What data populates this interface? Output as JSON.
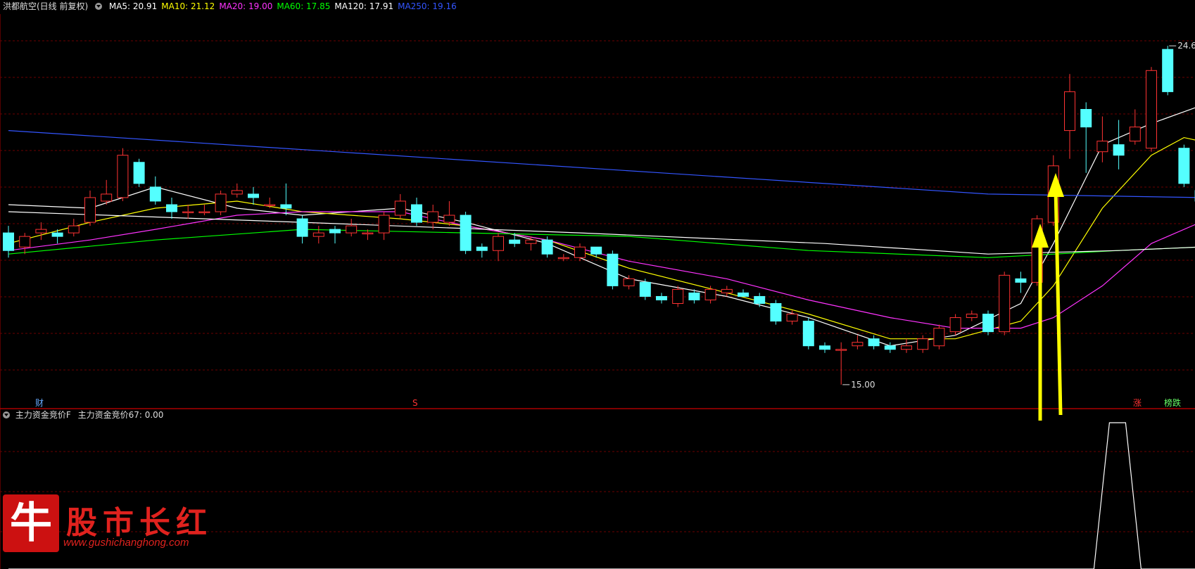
{
  "header": {
    "stock": "洪都航空(日线 前复权)",
    "indicators": [
      {
        "label": "MA5: 20.91",
        "color": "#ffffff"
      },
      {
        "label": "MA10: 21.12",
        "color": "#ffff00"
      },
      {
        "label": "MA20: 19.00",
        "color": "#ff33ff"
      },
      {
        "label": "MA60: 17.85",
        "color": "#00ff00"
      },
      {
        "label": "MA120: 17.91",
        "color": "#ffffff"
      },
      {
        "label": "MA250: 19.16",
        "color": "#3355ff"
      }
    ]
  },
  "sub_header": {
    "name": "主力资金竞价F",
    "value_label": "主力资金竞价67: 0.00"
  },
  "markers": {
    "cai": "财",
    "s": "S",
    "zhang": "涨",
    "bang": "榜跌"
  },
  "logo": {
    "glyph": "牛",
    "name": "股市长红",
    "url": "www.gushichanghong.com"
  },
  "colors": {
    "up": "#ff3333",
    "down": "#54ffff",
    "grid": "#6b0000",
    "bg": "#000000"
  },
  "chart_data": {
    "type": "candlestick",
    "price_range": [
      14.5,
      25.5
    ],
    "high_label": "24.60",
    "low_label": "15.00",
    "candles": [
      [
        19.3,
        18.8,
        19.5,
        18.6
      ],
      [
        18.9,
        19.2,
        19.3,
        18.7
      ],
      [
        19.3,
        19.4,
        19.6,
        19.1
      ],
      [
        19.3,
        19.2,
        19.4,
        19.0
      ],
      [
        19.3,
        19.5,
        19.7,
        19.2
      ],
      [
        19.6,
        20.3,
        20.5,
        19.5
      ],
      [
        20.2,
        20.4,
        20.8,
        20.1
      ],
      [
        20.3,
        21.5,
        21.7,
        20.2
      ],
      [
        21.3,
        20.7,
        21.4,
        20.6
      ],
      [
        20.6,
        20.2,
        20.9,
        20.1
      ],
      [
        20.1,
        19.9,
        20.3,
        19.7
      ],
      [
        19.9,
        19.9,
        20.1,
        19.7
      ],
      [
        19.9,
        19.9,
        20.1,
        19.8
      ],
      [
        19.9,
        20.4,
        20.5,
        19.8
      ],
      [
        20.4,
        20.5,
        20.7,
        20.3
      ],
      [
        20.4,
        20.3,
        20.6,
        20.1
      ],
      [
        20.1,
        20.1,
        20.3,
        20.0
      ],
      [
        20.1,
        20.0,
        20.7,
        19.8
      ],
      [
        19.7,
        19.2,
        19.8,
        19.0
      ],
      [
        19.2,
        19.3,
        19.5,
        19.0
      ],
      [
        19.4,
        19.3,
        19.5,
        19.0
      ],
      [
        19.3,
        19.5,
        19.7,
        19.2
      ],
      [
        19.3,
        19.3,
        19.4,
        19.1
      ],
      [
        19.3,
        19.8,
        19.9,
        19.1
      ],
      [
        19.8,
        20.2,
        20.4,
        19.7
      ],
      [
        20.1,
        19.6,
        20.3,
        19.5
      ],
      [
        19.6,
        19.9,
        20.1,
        19.4
      ],
      [
        19.6,
        19.8,
        20.2,
        19.5
      ],
      [
        19.8,
        18.8,
        19.9,
        18.7
      ],
      [
        18.9,
        18.8,
        19.0,
        18.6
      ],
      [
        18.8,
        19.2,
        19.3,
        18.5
      ],
      [
        19.1,
        19.0,
        19.3,
        18.9
      ],
      [
        19.0,
        19.1,
        19.2,
        18.8
      ],
      [
        19.1,
        18.7,
        19.2,
        18.6
      ],
      [
        18.6,
        18.6,
        18.7,
        18.5
      ],
      [
        18.6,
        18.9,
        19.0,
        18.5
      ],
      [
        18.9,
        18.7,
        18.9,
        18.6
      ],
      [
        18.7,
        17.8,
        18.8,
        17.7
      ],
      [
        17.8,
        18.0,
        18.1,
        17.7
      ],
      [
        17.9,
        17.5,
        18.0,
        17.4
      ],
      [
        17.5,
        17.4,
        17.6,
        17.3
      ],
      [
        17.3,
        17.7,
        17.8,
        17.2
      ],
      [
        17.6,
        17.4,
        17.7,
        17.3
      ],
      [
        17.4,
        17.7,
        17.8,
        17.3
      ],
      [
        17.6,
        17.7,
        17.8,
        17.5
      ],
      [
        17.6,
        17.5,
        17.7,
        17.5
      ],
      [
        17.5,
        17.3,
        17.6,
        17.2
      ],
      [
        17.3,
        16.8,
        17.4,
        16.7
      ],
      [
        16.8,
        17.0,
        17.1,
        16.7
      ],
      [
        16.8,
        16.1,
        16.9,
        16.0
      ],
      [
        16.1,
        16.0,
        16.2,
        15.9
      ],
      [
        16.0,
        16.0,
        16.2,
        15.0
      ],
      [
        16.1,
        16.2,
        16.4,
        16.0
      ],
      [
        16.3,
        16.1,
        16.4,
        16.0
      ],
      [
        16.1,
        16.0,
        16.2,
        15.9
      ],
      [
        16.0,
        16.1,
        16.3,
        15.9
      ],
      [
        16.0,
        16.3,
        16.4,
        15.9
      ],
      [
        16.1,
        16.6,
        16.7,
        16.0
      ],
      [
        16.5,
        16.9,
        17.0,
        16.4
      ],
      [
        16.9,
        17.0,
        17.1,
        16.8
      ],
      [
        17.0,
        16.5,
        17.1,
        16.4
      ],
      [
        16.5,
        18.1,
        18.2,
        16.4
      ],
      [
        18.0,
        17.9,
        18.2,
        17.6
      ],
      [
        17.9,
        19.7,
        19.8,
        17.8
      ],
      [
        19.6,
        21.2,
        21.5,
        19.5
      ],
      [
        22.2,
        23.3,
        23.8,
        21.4
      ],
      [
        22.8,
        22.3,
        23.0,
        21.0
      ],
      [
        21.6,
        21.9,
        22.6,
        21.3
      ],
      [
        21.8,
        21.5,
        22.5,
        21.1
      ],
      [
        21.9,
        22.3,
        22.8,
        21.8
      ],
      [
        21.7,
        23.9,
        24.0,
        21.6
      ],
      [
        24.5,
        23.3,
        24.6,
        23.2
      ],
      [
        21.7,
        20.7,
        21.8,
        20.6
      ],
      [
        20.5,
        20.2,
        21.3,
        20.2
      ]
    ],
    "ma_lines": [
      {
        "name": "MA5",
        "color": "#ffffff",
        "values": [
          [
            0,
            20.1
          ],
          [
            5,
            20.0
          ],
          [
            9,
            20.6
          ],
          [
            14,
            20.0
          ],
          [
            18,
            19.8
          ],
          [
            24,
            20.0
          ],
          [
            28,
            19.6
          ],
          [
            33,
            19.0
          ],
          [
            38,
            18.0
          ],
          [
            44,
            17.5
          ],
          [
            49,
            16.9
          ],
          [
            54,
            16.1
          ],
          [
            58,
            16.4
          ],
          [
            62,
            17.3
          ],
          [
            64,
            19.0
          ],
          [
            67,
            21.8
          ],
          [
            70,
            22.4
          ],
          [
            73,
            22.9
          ]
        ]
      },
      {
        "name": "MA10",
        "color": "#ffff00",
        "values": [
          [
            0,
            19.0
          ],
          [
            5,
            19.6
          ],
          [
            9,
            20.0
          ],
          [
            14,
            20.2
          ],
          [
            18,
            19.9
          ],
          [
            24,
            19.7
          ],
          [
            28,
            19.5
          ],
          [
            33,
            19.1
          ],
          [
            38,
            18.3
          ],
          [
            44,
            17.6
          ],
          [
            49,
            17.0
          ],
          [
            54,
            16.3
          ],
          [
            58,
            16.3
          ],
          [
            62,
            16.8
          ],
          [
            64,
            17.8
          ],
          [
            67,
            20.0
          ],
          [
            70,
            21.5
          ],
          [
            72,
            22.0
          ],
          [
            73,
            21.9
          ]
        ]
      },
      {
        "name": "MA20",
        "color": "#ff33ff",
        "values": [
          [
            0,
            18.8
          ],
          [
            5,
            19.1
          ],
          [
            9,
            19.4
          ],
          [
            14,
            19.8
          ],
          [
            18,
            19.9
          ],
          [
            24,
            19.9
          ],
          [
            28,
            19.5
          ],
          [
            33,
            19.1
          ],
          [
            38,
            18.5
          ],
          [
            44,
            18.0
          ],
          [
            49,
            17.4
          ],
          [
            54,
            16.9
          ],
          [
            58,
            16.6
          ],
          [
            62,
            16.6
          ],
          [
            64,
            16.9
          ],
          [
            67,
            17.8
          ],
          [
            70,
            19.0
          ],
          [
            73,
            19.6
          ]
        ]
      },
      {
        "name": "MA60",
        "color": "#00ff00",
        "values": [
          [
            0,
            18.7
          ],
          [
            9,
            19.1
          ],
          [
            18,
            19.4
          ],
          [
            28,
            19.3
          ],
          [
            38,
            19.2
          ],
          [
            49,
            18.8
          ],
          [
            60,
            18.6
          ],
          [
            68,
            18.8
          ],
          [
            73,
            18.9
          ]
        ]
      },
      {
        "name": "MA120",
        "color": "#ffffff",
        "values": [
          [
            0,
            19.9
          ],
          [
            18,
            19.6
          ],
          [
            35,
            19.3
          ],
          [
            50,
            19.0
          ],
          [
            60,
            18.7
          ],
          [
            68,
            18.8
          ],
          [
            73,
            18.9
          ]
        ]
      },
      {
        "name": "MA250",
        "color": "#3355ff",
        "values": [
          [
            0,
            22.2
          ],
          [
            20,
            21.6
          ],
          [
            40,
            21.0
          ],
          [
            60,
            20.4
          ],
          [
            73,
            20.3
          ]
        ]
      }
    ],
    "indicator": {
      "name": "主力资金竞价67",
      "values": [
        [
          0,
          0
        ],
        [
          67,
          0
        ],
        [
          68,
          1
        ],
        [
          69,
          1
        ],
        [
          70,
          0
        ],
        [
          73,
          0
        ]
      ]
    }
  }
}
